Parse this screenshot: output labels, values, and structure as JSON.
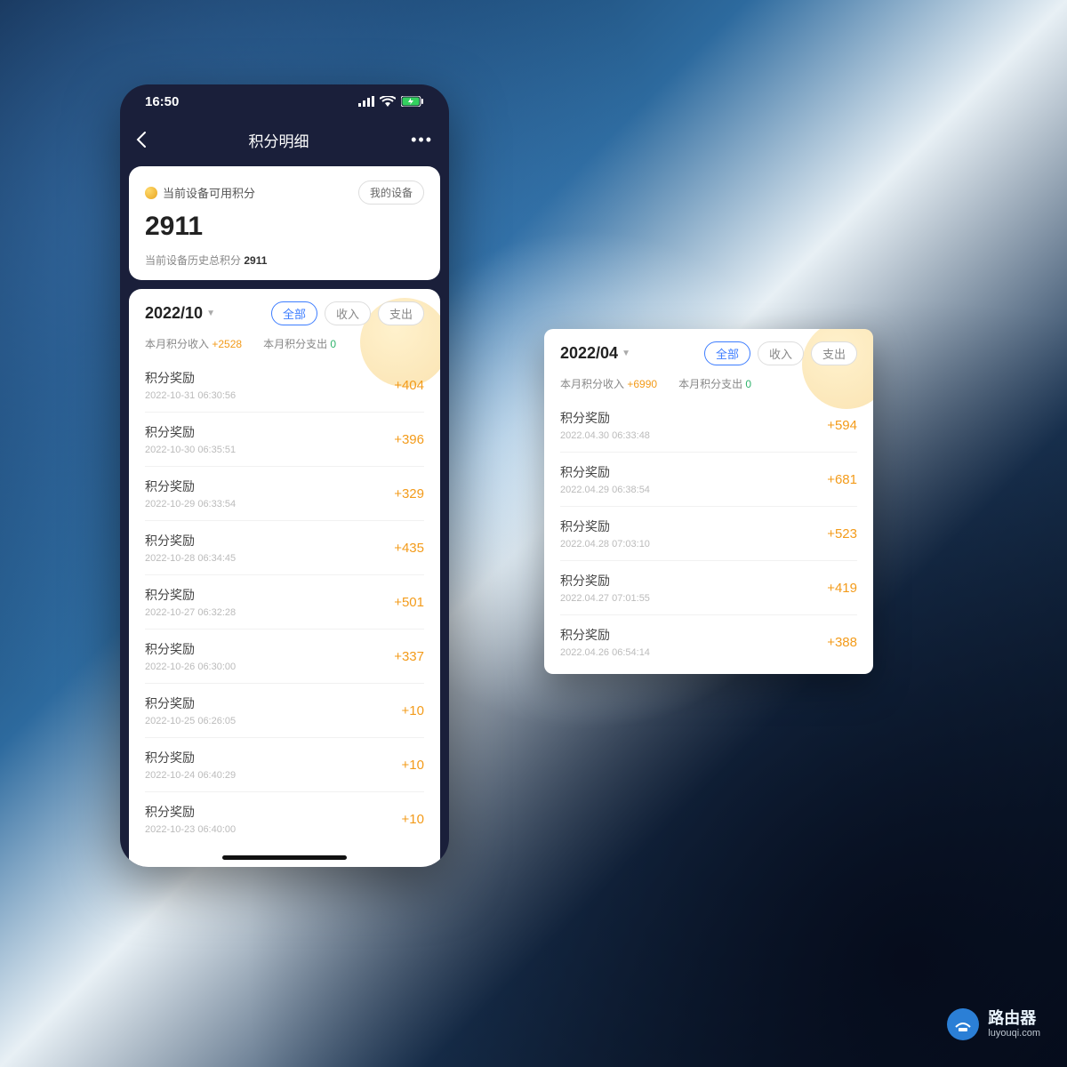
{
  "statusbar": {
    "time": "16:50"
  },
  "navbar": {
    "title": "积分明细"
  },
  "card": {
    "device_points_label": "当前设备可用积分",
    "my_device_btn": "我的设备",
    "points": "2911",
    "history_label": "当前设备历史总积分",
    "history_value": "2911"
  },
  "left": {
    "month": "2022/10",
    "tabs": {
      "all": "全部",
      "income": "收入",
      "expense": "支出"
    },
    "income_label": "本月积分收入",
    "income_value": "+2528",
    "expense_label": "本月积分支出",
    "expense_value": "0",
    "items": [
      {
        "title": "积分奖励",
        "ts": "2022-10-31 06:30:56",
        "val": "+404"
      },
      {
        "title": "积分奖励",
        "ts": "2022-10-30 06:35:51",
        "val": "+396"
      },
      {
        "title": "积分奖励",
        "ts": "2022-10-29 06:33:54",
        "val": "+329"
      },
      {
        "title": "积分奖励",
        "ts": "2022-10-28 06:34:45",
        "val": "+435"
      },
      {
        "title": "积分奖励",
        "ts": "2022-10-27 06:32:28",
        "val": "+501"
      },
      {
        "title": "积分奖励",
        "ts": "2022-10-26 06:30:00",
        "val": "+337"
      },
      {
        "title": "积分奖励",
        "ts": "2022-10-25 06:26:05",
        "val": "+10"
      },
      {
        "title": "积分奖励",
        "ts": "2022-10-24 06:40:29",
        "val": "+10"
      },
      {
        "title": "积分奖励",
        "ts": "2022-10-23 06:40:00",
        "val": "+10"
      }
    ]
  },
  "right": {
    "month": "2022/04",
    "tabs": {
      "all": "全部",
      "income": "收入",
      "expense": "支出"
    },
    "income_label": "本月积分收入",
    "income_value": "+6990",
    "expense_label": "本月积分支出",
    "expense_value": "0",
    "items": [
      {
        "title": "积分奖励",
        "ts": "2022.04.30 06:33:48",
        "val": "+594"
      },
      {
        "title": "积分奖励",
        "ts": "2022.04.29 06:38:54",
        "val": "+681"
      },
      {
        "title": "积分奖励",
        "ts": "2022.04.28 07:03:10",
        "val": "+523"
      },
      {
        "title": "积分奖励",
        "ts": "2022.04.27 07:01:55",
        "val": "+419"
      },
      {
        "title": "积分奖励",
        "ts": "2022.04.26 06:54:14",
        "val": "+388"
      }
    ]
  },
  "watermark": {
    "main": "路由器",
    "sub": "luyouqi.com"
  }
}
